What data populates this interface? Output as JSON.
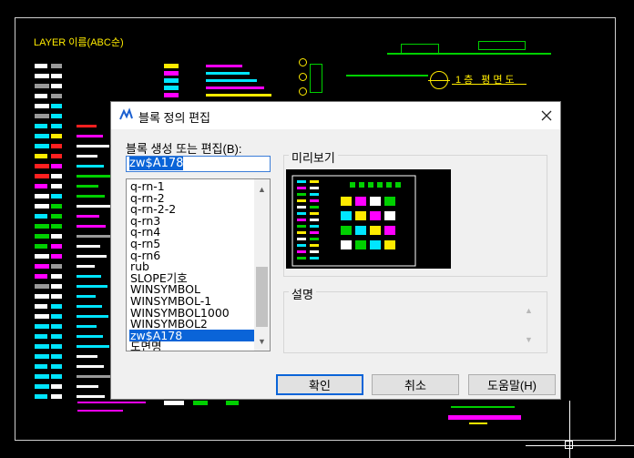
{
  "cad": {
    "layer_title": "LAYER 이름(ABC순)",
    "floor_label": "1층 평면도",
    "colors": {
      "yellow": "#ffeb00",
      "cyan": "#00e5ff",
      "magenta": "#ff00ff",
      "green": "#00d000",
      "white": "#ffffff",
      "red": "#ff2020",
      "gray": "#9a9a9a"
    }
  },
  "dialog": {
    "title": "블록 정의 편집",
    "close_icon": "close-icon",
    "create_label": "블록 생성 또는 편집(B):",
    "block_name_value": "zw$A178",
    "block_list": [
      "q-rn-1",
      "q-rn-2",
      "q-rn-2-2",
      "q-rn3",
      "q-rn4",
      "q-rn5",
      "q-rn6",
      "rub",
      "SLOPE기호",
      "WINSYMBOL",
      "WINSYMBOL-1",
      "WINSYMBOL1000",
      "WINSYMBOL2",
      "zw$A178",
      "도면명"
    ],
    "selected_item": "zw$A178",
    "preview_label": "미리보기",
    "description_label": "설명",
    "buttons": {
      "ok": "확인",
      "cancel": "취소",
      "help": "도움말(H)"
    }
  }
}
